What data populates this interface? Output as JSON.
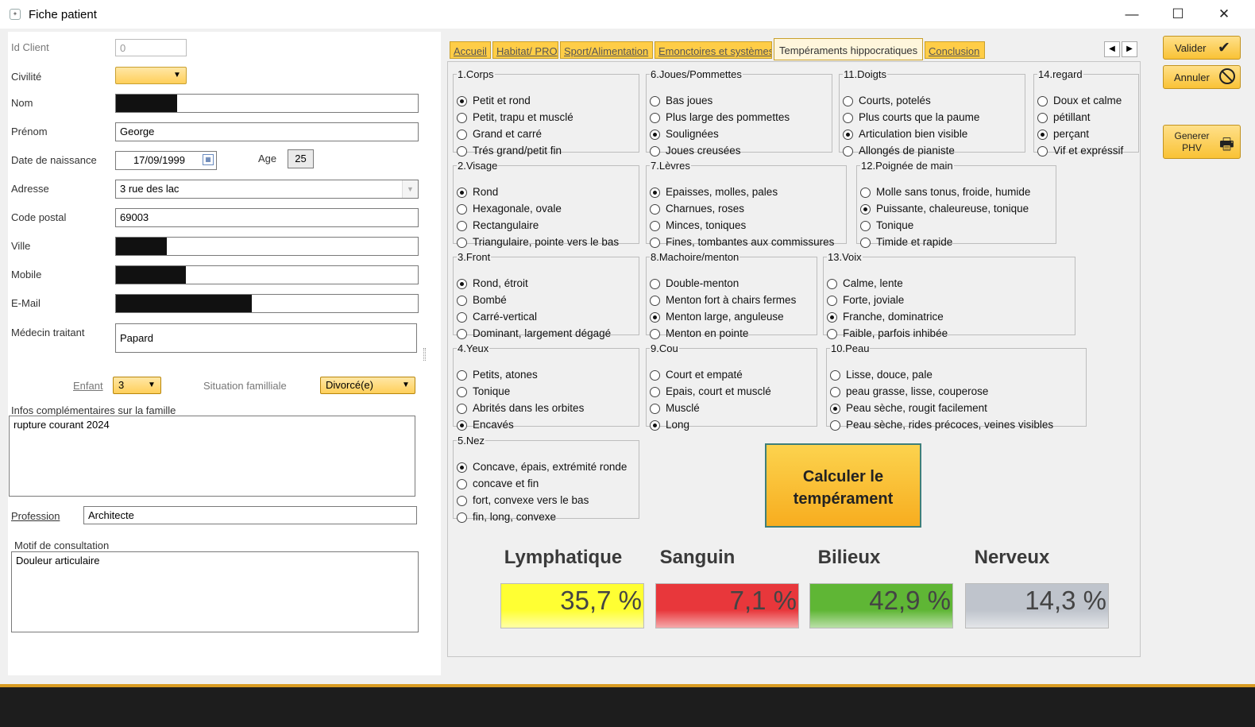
{
  "window": {
    "title": "Fiche patient"
  },
  "form": {
    "id_client_label": "Id Client",
    "id_client": "0",
    "civilite_label": "Civilité",
    "nom_label": "Nom",
    "prenom_label": "Prénom",
    "prenom": "George",
    "dob_label": "Date de naissance",
    "dob": "17/09/1999",
    "age_label": "Age",
    "age": "25",
    "adresse_label": "Adresse",
    "adresse": "3 rue des lac",
    "cp_label": "Code postal",
    "cp": "69003",
    "ville_label": "Ville",
    "mobile_label": "Mobile",
    "email_label": "E-Mail",
    "medecin_label": "Médecin traitant",
    "medecin": "Papard",
    "enfant_label": "Enfant",
    "enfant": "3",
    "situation_label": "Situation familliale",
    "situation": "Divorcé(e)",
    "infos_label": "Infos complémentaires sur la famille",
    "infos": "rupture courant 2024",
    "profession_label": "Profession",
    "profession": "Architecte",
    "motif_label": "Motif de consultation",
    "motif": "Douleur articulaire"
  },
  "tabs": [
    "Accueil",
    "Habitat/ PRO",
    "Sport/Alimentation",
    "Emonctoires et systèmes",
    "Tempéraments hippocratiques",
    "Conclusion"
  ],
  "active_tab": "Tempéraments hippocratiques",
  "groups": [
    {
      "legend": "1.Corps",
      "options": [
        "Petit et rond",
        "Petit, trapu et musclé",
        "Grand et carré",
        "Trés grand/petit fin"
      ],
      "selected": 0
    },
    {
      "legend": "6.Joues/Pommettes",
      "options": [
        "Bas joues",
        "Plus large des pommettes",
        "Soulignées",
        "Joues creusées"
      ],
      "selected": 2
    },
    {
      "legend": "11.Doigts",
      "options": [
        "Courts, potelés",
        "Plus courts que la paume",
        "Articulation bien visible",
        "Allongés de pianiste"
      ],
      "selected": 2
    },
    {
      "legend": "14.regard",
      "options": [
        "Doux et calme",
        "pétillant",
        "perçant",
        "Vif et expréssif"
      ],
      "selected": 2
    },
    {
      "legend": "2.Visage",
      "options": [
        "Rond",
        "Hexagonale, ovale",
        "Rectangulaire",
        "Triangulaire, pointe vers le bas"
      ],
      "selected": 0
    },
    {
      "legend": "7.Lèvres",
      "options": [
        "Epaisses, molles, pales",
        "Charnues, roses",
        "Minces, toniques",
        "Fines, tombantes aux commissures"
      ],
      "selected": 0
    },
    {
      "legend": "12.Poignée de main",
      "options": [
        "Molle sans tonus, froide, humide",
        "Puissante, chaleureuse, tonique",
        "Tonique",
        "Timide et rapide"
      ],
      "selected": 1
    },
    {
      "legend": "3.Front",
      "options": [
        "Rond, étroit",
        "Bombé",
        "Carré-vertical",
        "Dominant, largement dégagé"
      ],
      "selected": 0
    },
    {
      "legend": "8.Machoire/menton",
      "options": [
        "Double-menton",
        "Menton fort à chairs fermes",
        "Menton large, anguleuse",
        "Menton en pointe"
      ],
      "selected": 2
    },
    {
      "legend": "13.Voix",
      "options": [
        "Calme, lente",
        "Forte, joviale",
        "Franche, dominatrice",
        "Faible, parfois inhibée"
      ],
      "selected": 2
    },
    {
      "legend": "4.Yeux",
      "options": [
        "Petits, atones",
        "Tonique",
        "Abrités dans les orbites",
        "Encavés"
      ],
      "selected": 3
    },
    {
      "legend": "9.Cou",
      "options": [
        "Court et empaté",
        "Epais, court et musclé",
        "Musclé",
        "Long"
      ],
      "selected": 3
    },
    {
      "legend": "10.Peau",
      "options": [
        "Lisse, douce, pale",
        "peau grasse, lisse, couperose",
        "Peau sèche, rougit facilement",
        "Peau sèche, rides précoces, veines visibles"
      ],
      "selected": 2
    },
    {
      "legend": "5.Nez",
      "options": [
        "Concave, épais, extrémité ronde",
        "concave et fin",
        "fort, convexe vers le bas",
        "fin, long, convexe"
      ],
      "selected": 0
    }
  ],
  "calc_button": "Calculer le tempérament",
  "results": [
    {
      "name": "Lymphatique",
      "value": "35,7 %",
      "color": "#ffff33"
    },
    {
      "name": "Sanguin",
      "value": "7,1 %",
      "color": "#e8373b"
    },
    {
      "name": "Bilieux",
      "value": "42,9 %",
      "color": "#5fb635"
    },
    {
      "name": "Nerveux",
      "value": "14,3 %",
      "color": "#bfc4cc"
    }
  ],
  "actions": {
    "valider": "Valider",
    "annuler": "Annuler",
    "generer": "Generer PHV"
  }
}
